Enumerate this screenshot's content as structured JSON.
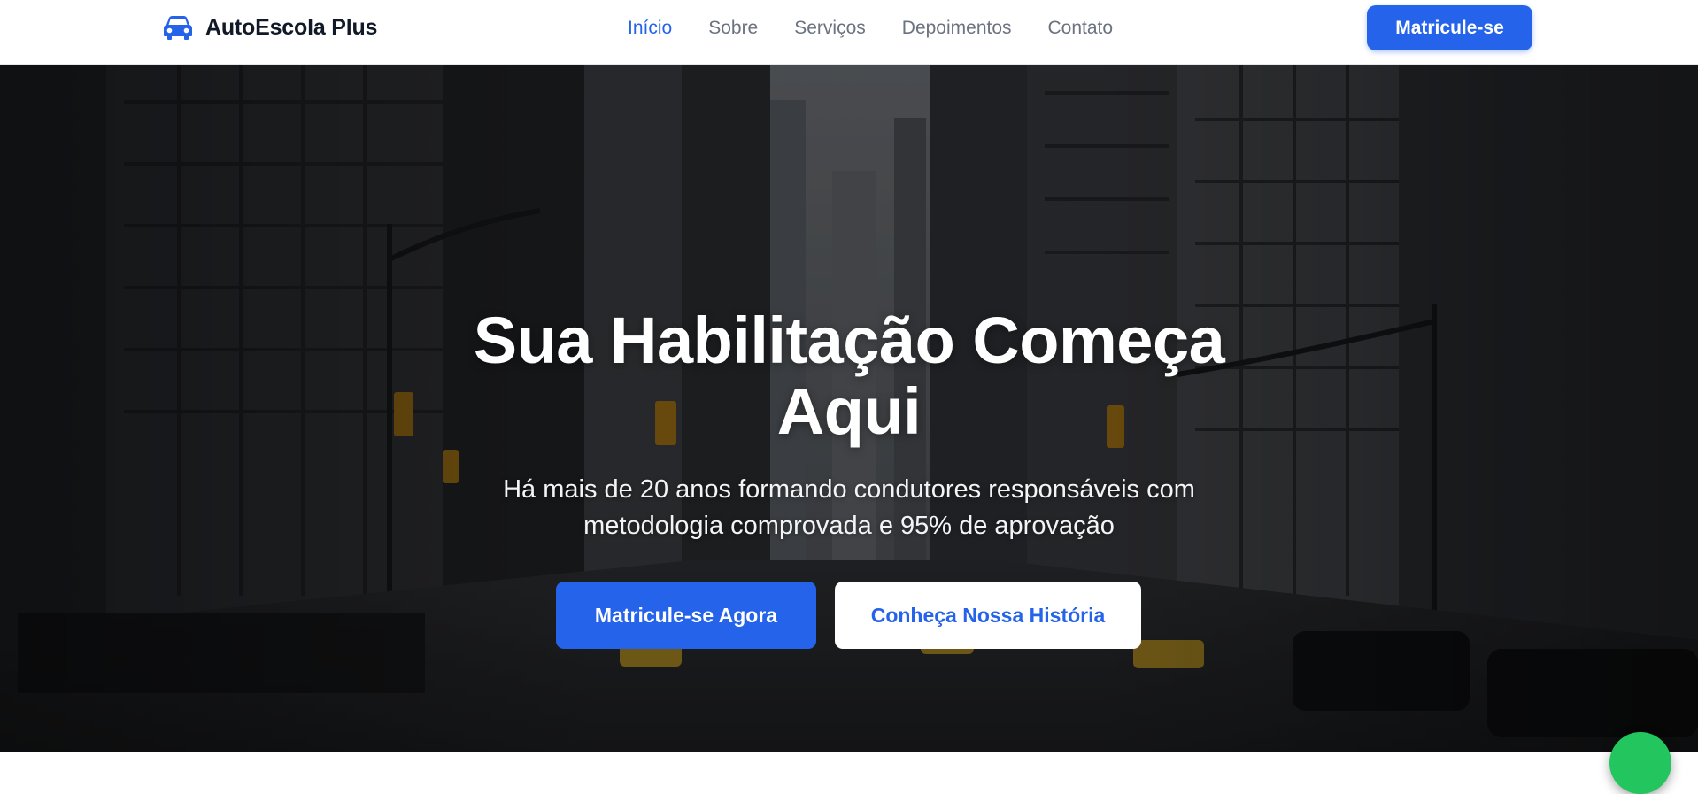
{
  "navbar": {
    "brand": {
      "icon": "car-icon",
      "name": "AutoEscola Plus"
    },
    "links": [
      {
        "label": "Início",
        "active": true
      },
      {
        "label": "Sobre",
        "active": false
      },
      {
        "label": "Serviços",
        "active": false
      },
      {
        "label": "Depoimentos",
        "active": false
      },
      {
        "label": "Contato",
        "active": false
      }
    ],
    "cta_label": "Matricule-se"
  },
  "hero": {
    "title": "Sua Habilitação Começa Aqui",
    "subtitle": "Há mais de 20 anos formando condutores responsáveis com metodologia comprovada e 95% de aprovação",
    "primary_button": "Matricule-se Agora",
    "secondary_button": "Conheça Nossa História",
    "background": "city-street-photo"
  },
  "floating": {
    "icon": "whatsapp-icon"
  },
  "colors": {
    "accent": "#2563eb",
    "nav_text": "#6b7280",
    "brand_text": "#111827",
    "whatsapp": "#22c55e"
  }
}
